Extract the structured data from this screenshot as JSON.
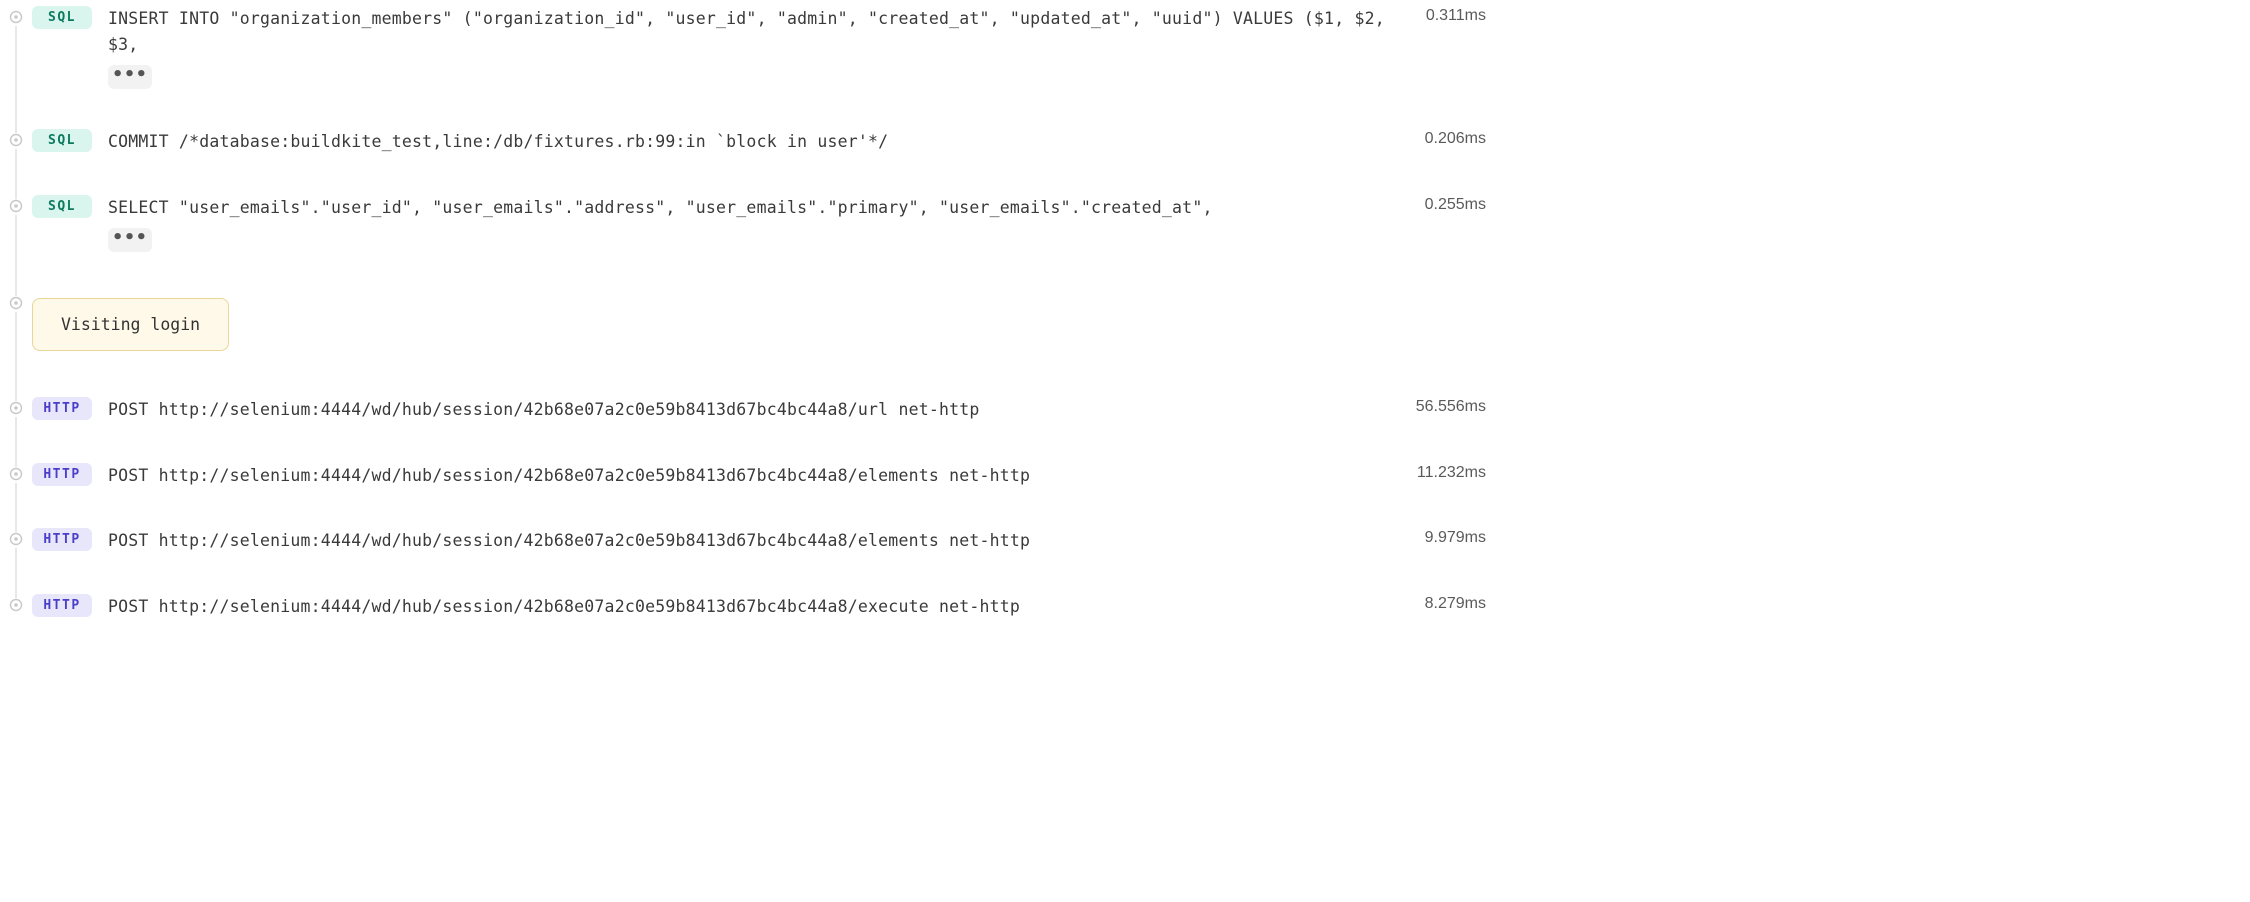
{
  "badges": {
    "sql": "SQL",
    "http": "HTTP"
  },
  "ellipsis": "•••",
  "rows": [
    {
      "type": "sql",
      "text": "INSERT INTO \"organization_members\" (\"organization_id\", \"user_id\", \"admin\", \"created_at\", \"updated_at\", \"uuid\") VALUES ($1, $2, $3,",
      "duration": "0.311ms",
      "truncated": true
    },
    {
      "type": "sql",
      "text": "COMMIT /*database:buildkite_test,line:/db/fixtures.rb:99:in `block in user'*/",
      "duration": "0.206ms",
      "truncated": false
    },
    {
      "type": "sql",
      "text": "SELECT \"user_emails\".\"user_id\", \"user_emails\".\"address\", \"user_emails\".\"primary\", \"user_emails\".\"created_at\",",
      "duration": "0.255ms",
      "truncated": true
    },
    {
      "type": "annotation",
      "text": "Visiting login"
    },
    {
      "type": "http",
      "text": "POST http://selenium:4444/wd/hub/session/42b68e07a2c0e59b8413d67bc4bc44a8/url net-http",
      "duration": "56.556ms",
      "truncated": false
    },
    {
      "type": "http",
      "text": "POST http://selenium:4444/wd/hub/session/42b68e07a2c0e59b8413d67bc4bc44a8/elements net-http",
      "duration": "11.232ms",
      "truncated": false
    },
    {
      "type": "http",
      "text": "POST http://selenium:4444/wd/hub/session/42b68e07a2c0e59b8413d67bc4bc44a8/elements net-http",
      "duration": "9.979ms",
      "truncated": false
    },
    {
      "type": "http",
      "text": "POST http://selenium:4444/wd/hub/session/42b68e07a2c0e59b8413d67bc4bc44a8/execute net-http",
      "duration": "8.279ms",
      "truncated": false
    }
  ]
}
